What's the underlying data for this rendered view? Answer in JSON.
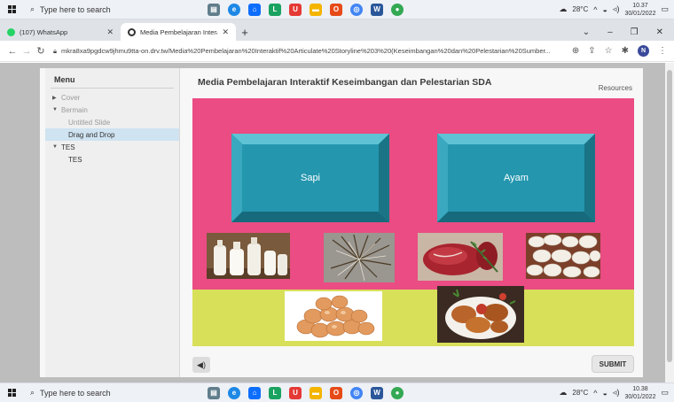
{
  "taskbar_top": {
    "search_placeholder": "Type here to search",
    "weather": "28°C",
    "time": "10.37",
    "date": "30/01/2022"
  },
  "taskbar_bottom": {
    "search_placeholder": "Type here to search",
    "weather": "28°C",
    "time": "10.38",
    "date": "30/01/2022"
  },
  "browser": {
    "tabs": [
      {
        "label": "(107) WhatsApp",
        "favicon_color": "#25d366"
      },
      {
        "label": "Media Pembelajaran Interaktif Ke",
        "favicon_color": "#333333"
      }
    ],
    "url": "mkra8xa9pgdcw9jhmu9tta-on.drv.tw/Media%20Pembelajaran%20Interaktif%20Articulate%20Storyline%203%20(Keseimbangan%20dan%20Pelestarian%20Sumber...",
    "profile_initial": "N"
  },
  "player": {
    "menu_title": "Menu",
    "menu_items": [
      {
        "label": "Cover"
      },
      {
        "label": "Bermain"
      },
      {
        "label": "Untitled Slide"
      },
      {
        "label": "Drag and Drop"
      },
      {
        "label": "TES"
      },
      {
        "label": "TES"
      }
    ],
    "title": "Media Pembelajaran Interaktif Keseimbangan dan Pelestarian SDA",
    "resources_label": "Resources",
    "targets": [
      "Sapi",
      "Ayam"
    ],
    "submit_label": "SUBMIT"
  },
  "colors": {
    "slide_bg": "#ea4c83",
    "band": "#d8e05a",
    "target": "#2496ae"
  },
  "icons": [
    "windows-logo",
    "search-icon",
    "volume-icon",
    "star-icon",
    "extensions-icon",
    "lock-icon"
  ]
}
